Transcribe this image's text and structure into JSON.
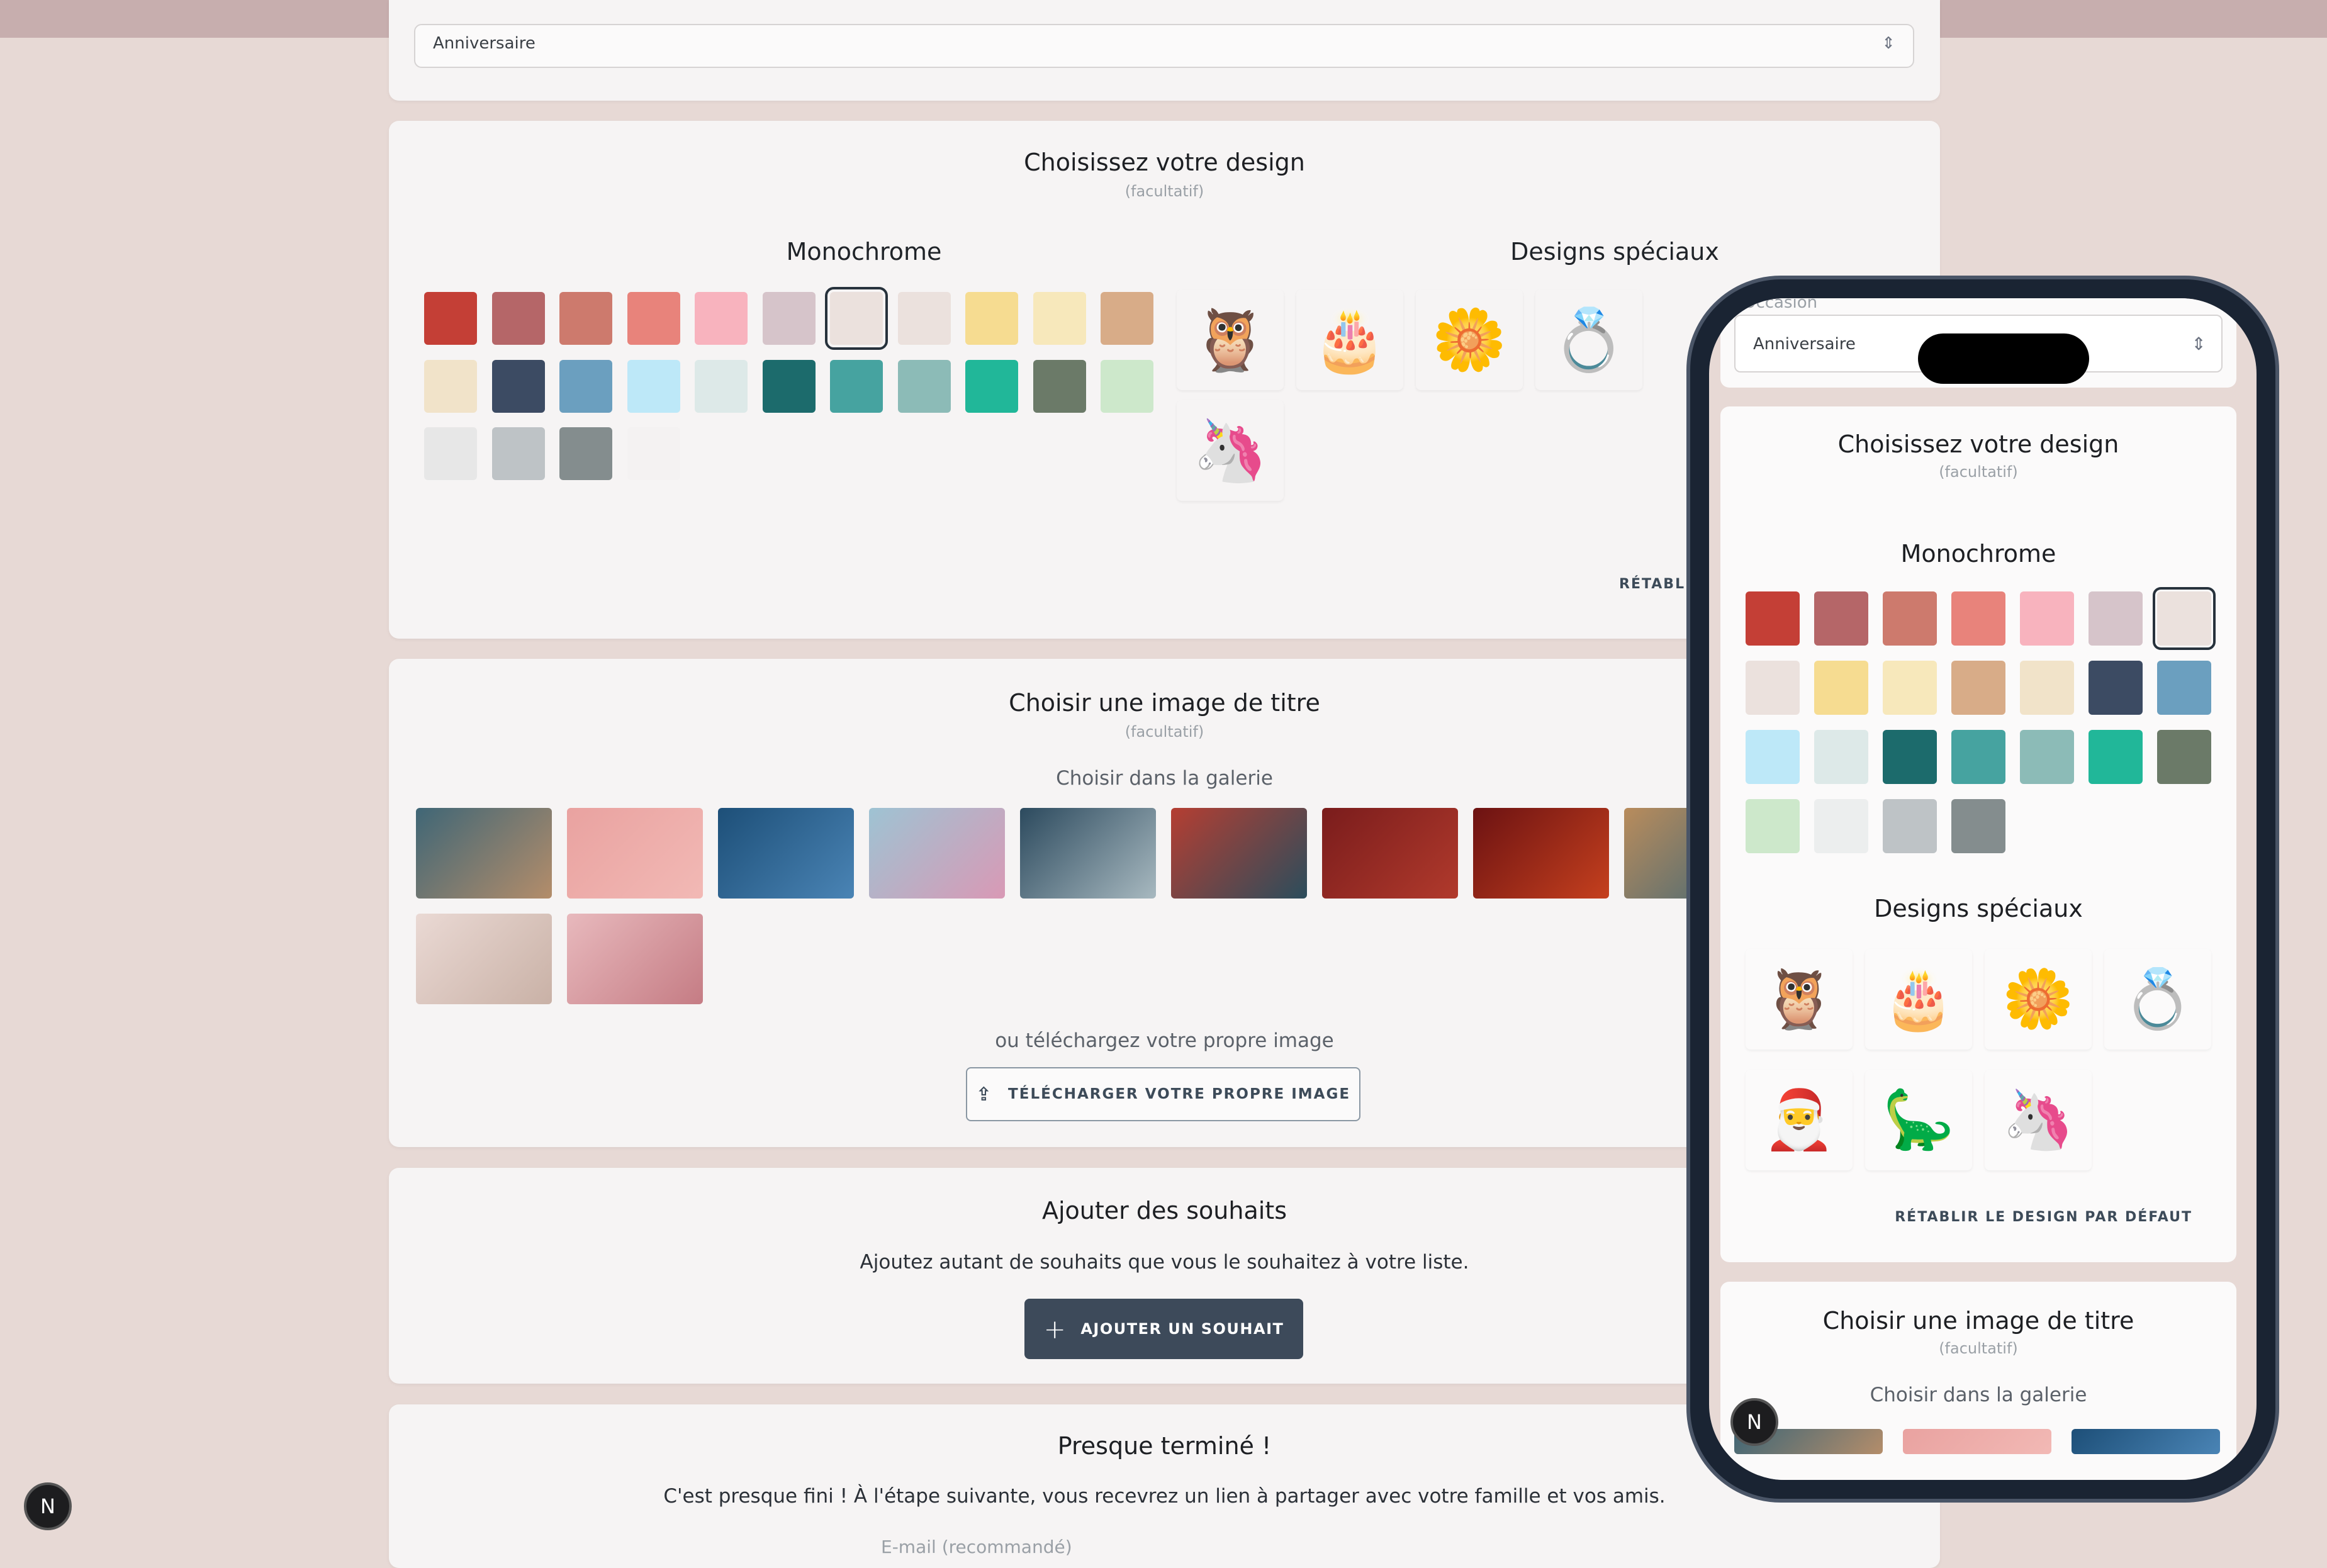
{
  "occasion": {
    "value": "Anniversaire",
    "chevron": "⌃⌄"
  },
  "design": {
    "title": "Choisissez votre design",
    "optional": "(facultatif)",
    "monochrome_label": "Monochrome",
    "special_label": "Designs spéciaux",
    "reset_label": "RÉTABLIR LE DESIGN PAR DÉFAUT",
    "reset_truncated": "RÉTABLI",
    "colors": [
      "#c43f36",
      "#b56668",
      "#cd7a6d",
      "#e8837b",
      "#f8b3be",
      "#d6c4ca",
      "#ebe1dd",
      "#ebe1dd",
      "#f6dc91",
      "#f7e8bb",
      "#d8ac88",
      "#f1e3c9",
      "#3c4b63",
      "#6b9fbf",
      "#bde8f8",
      "#dde9e8",
      "#1c6b6c",
      "#46a3a0",
      "#8cbbb7",
      "#21b799",
      "#6b7a68",
      "#cde8cb",
      "#e7e7e7",
      "#bec3c6",
      "#848d8e"
    ],
    "selected_index": 6,
    "specials": [
      {
        "name": "owl-flowers",
        "glyph": "🦉"
      },
      {
        "name": "birthday-cake-balloon",
        "glyph": "🎂"
      },
      {
        "name": "white-flower",
        "glyph": "🌼"
      },
      {
        "name": "flower-rings",
        "glyph": "💍"
      },
      {
        "name": "unicorn",
        "glyph": "🦄"
      }
    ]
  },
  "phone_design": {
    "colors": [
      "#c43f36",
      "#b56668",
      "#cd7a6d",
      "#e8837b",
      "#f8b3be",
      "#d6c4ca",
      "#ebe1dd",
      "#ebe1dd",
      "#f6dc91",
      "#f7e8bb",
      "#d8ac88",
      "#f1e3c9",
      "#3c4b63",
      "#6b9fbf",
      "#bde8f8",
      "#dde9e8",
      "#1c6b6c",
      "#46a3a0",
      "#8cbbb7",
      "#21b799",
      "#6b7a68",
      "#cde8cb",
      "#eceeee",
      "#bec3c6",
      "#848d8e"
    ],
    "selected_index": 6,
    "specials": [
      {
        "name": "owl-flowers",
        "glyph": "🦉"
      },
      {
        "name": "birthday-cake-balloon",
        "glyph": "🎂"
      },
      {
        "name": "white-flower",
        "glyph": "🌼"
      },
      {
        "name": "flower-rings",
        "glyph": "💍"
      },
      {
        "name": "santa-claus",
        "glyph": "🎅"
      },
      {
        "name": "dinosaur",
        "glyph": "🦕"
      },
      {
        "name": "unicorn",
        "glyph": "🦄"
      }
    ]
  },
  "title_image": {
    "title": "Choisir une image de titre",
    "optional": "(facultatif)",
    "gallery_label": "Choisir dans la galerie",
    "upload_hint": "ou téléchargez votre propre image",
    "upload_button": "TÉLÉCHARGER VOTRE PROPRE IMAGE",
    "images": [
      {
        "name": "elephant-boy",
        "colors": [
          "#3f6676",
          "#b48d6a"
        ]
      },
      {
        "name": "pink-cake",
        "colors": [
          "#e9a2a0",
          "#f2b9b5"
        ]
      },
      {
        "name": "blue-toys",
        "colors": [
          "#1d4f78",
          "#4a84b5"
        ]
      },
      {
        "name": "pink-balloons",
        "colors": [
          "#9ec3d3",
          "#d999b5"
        ]
      },
      {
        "name": "winter-deer",
        "colors": [
          "#2c4a5e",
          "#a8b9c0"
        ]
      },
      {
        "name": "santa-gnome",
        "colors": [
          "#b53e32",
          "#2b4d5c"
        ]
      },
      {
        "name": "santa-gifts",
        "colors": [
          "#7a1c1c",
          "#b13a2c"
        ]
      },
      {
        "name": "red-gift-bokeh",
        "colors": [
          "#6c1212",
          "#c5401e"
        ]
      },
      {
        "name": "autumn-leaves",
        "colors": [
          "#b98c5c",
          "#3f6676"
        ]
      },
      {
        "name": "rings-roses",
        "colors": [
          "#ead9d4",
          "#c9b1a6"
        ]
      },
      {
        "name": "pink-peony",
        "colors": [
          "#e8b9bd",
          "#c57c84"
        ]
      }
    ]
  },
  "wishes": {
    "title": "Ajouter des souhaits",
    "description": "Ajoutez autant de souhaits que vous le souhaitez à votre liste.",
    "add_button": "AJOUTER UN SOUHAIT"
  },
  "almost": {
    "title": "Presque terminé !",
    "description": "C'est presque fini ! À l'étape suivante, vous recevrez un lien à partager avec votre famille et vos amis.",
    "email_placeholder": "E-mail (recommandé)"
  },
  "phone": {
    "occasion_label": "Occasion",
    "occasion_value": "Anniversaire"
  },
  "badge": "N"
}
